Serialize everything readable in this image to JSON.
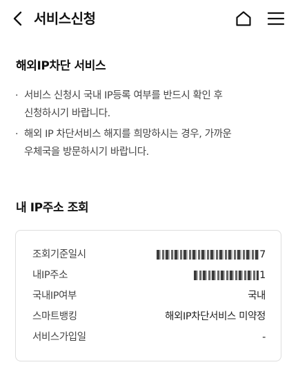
{
  "header": {
    "title": "서비스신청",
    "back_icon": "chevron-left-icon",
    "home_icon": "home-icon",
    "menu_icon": "hamburger-menu-icon"
  },
  "service_section": {
    "title": "해외IP차단 서비스",
    "notices": [
      {
        "bullet": "·",
        "lines": [
          "서비스 신청시 국내 IP등록 여부를 반드시 확인 후",
          "신청하시기 바랍니다."
        ]
      },
      {
        "bullet": "·",
        "lines": [
          "해외 IP 차단서비스 해지를 희망하시는 경우, 가까운",
          "우체국을 방문하시기 바랍니다."
        ]
      }
    ]
  },
  "ip_section": {
    "title": "내 IP주소 조회",
    "rows": [
      {
        "label": "조회기준일시",
        "value_suffix": "7",
        "masked": true
      },
      {
        "label": "내IP주소",
        "value_suffix": "1",
        "masked": true
      },
      {
        "label": "국내IP여부",
        "value": "국내"
      },
      {
        "label": "스마트뱅킹",
        "value": "해외IP차단서비스 미약정"
      },
      {
        "label": "서비스가입일",
        "value": "-"
      }
    ]
  },
  "colors": {
    "text_primary": "#111111",
    "text_secondary": "#444444",
    "card_border": "#dddddd",
    "background": "#ffffff"
  }
}
